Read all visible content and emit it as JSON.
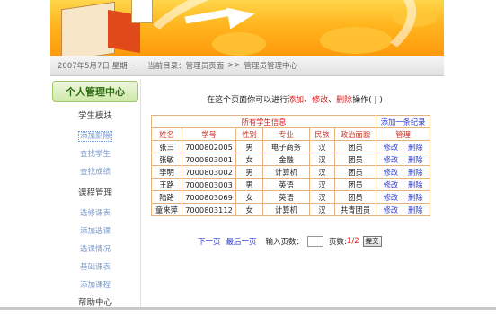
{
  "breadcrumb": {
    "date": "2007年5月7日 星期一",
    "current_label": "当前目录：",
    "crumb1": "管理员页面",
    "separator": ">>",
    "crumb2": "管理员管理中心"
  },
  "sidebar": {
    "title": "个人管理中心",
    "section1": "学生模块",
    "section1_items": [
      "添加删除",
      "查找学生",
      "查找成绩"
    ],
    "section2": "课程管理",
    "section2_items": [
      "选修课表",
      "添加选课",
      "选课情况",
      "基础课表",
      "添加课程"
    ],
    "section3": "帮助中心"
  },
  "notice": {
    "prefix": "在这个页面你可以进行",
    "add": "添加",
    "sep1": "、",
    "edit": "修改",
    "sep2": "、",
    "del": "删除",
    "suffix": "操作( | )"
  },
  "table": {
    "caption": "所有学生信息",
    "add_record": "添加一条纪录",
    "headers": [
      "姓名",
      "学号",
      "性别",
      "专业",
      "民族",
      "政治面貌",
      "管理"
    ],
    "rows": [
      [
        "张三",
        "7000802005",
        "男",
        "电子商务",
        "汉",
        "团员"
      ],
      [
        "张敏",
        "7000803001",
        "女",
        "金融",
        "汉",
        "团员"
      ],
      [
        "李明",
        "7000803002",
        "男",
        "计算机",
        "汉",
        "团员"
      ],
      [
        "王路",
        "7000803003",
        "男",
        "英语",
        "汉",
        "团员"
      ],
      [
        "陆路",
        "7000803069",
        "女",
        "英语",
        "汉",
        "团员"
      ],
      [
        "童来萍",
        "7000803112",
        "女",
        "计算机",
        "汉",
        "共青团员"
      ]
    ],
    "edit_label": "修改",
    "divider": "|",
    "delete_label": "删除"
  },
  "pager": {
    "next": "下一页",
    "last": "最后一页",
    "input_label": "输入页数：",
    "page_label": "页数:",
    "page_value": "1/2",
    "submit": "提交"
  },
  "colors": {
    "accent_red": "#e21a1a",
    "link_blue": "#2b3dd6",
    "table_border": "#e6b37f",
    "banner_orange": "#ffb51e"
  }
}
